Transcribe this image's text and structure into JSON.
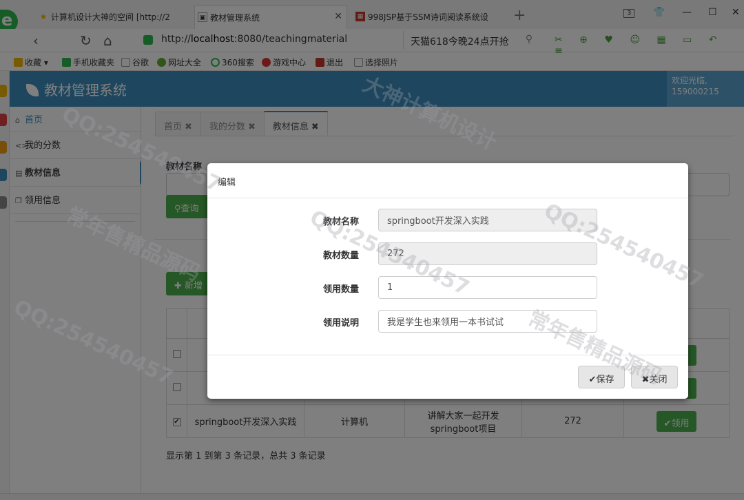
{
  "browser": {
    "tabs": [
      {
        "title": "计算机设计大神的空间 [http://2"
      },
      {
        "title": "教材管理系统"
      },
      {
        "title": "998JSP基于SSM诗词阅读系统设"
      }
    ],
    "tab_count": "3",
    "url_prefix": "http://",
    "url_host": "localhost",
    "url_path": ":8080/teachingmaterial",
    "search_promo": "天猫618今晚24点开抢",
    "bookmarks": [
      "收藏",
      "手机收藏夹",
      "谷歌",
      "网址大全",
      "360搜索",
      "游戏中心",
      "退出",
      "选择照片"
    ]
  },
  "app": {
    "title": "教材管理系统",
    "welcome_line1": "欢迎光临,",
    "welcome_line2": "159000215"
  },
  "sidebar": {
    "items": [
      {
        "label": "首页",
        "icon": "home-icon"
      },
      {
        "label": "我的分数",
        "icon": "code-icon"
      },
      {
        "label": "教材信息",
        "icon": "book-icon"
      },
      {
        "label": "领用信息",
        "icon": "clone-icon"
      }
    ]
  },
  "content_tabs": [
    {
      "label": "首页"
    },
    {
      "label": "我的分数"
    },
    {
      "label": "教材信息"
    }
  ],
  "search": {
    "label": "教材名称",
    "query_button": "查询"
  },
  "toolbar": {
    "add_button": "新增"
  },
  "table": {
    "rows": [
      {
        "checked": false,
        "name": "",
        "category": "",
        "desc1": "",
        "desc2": "",
        "qty": "",
        "action": ""
      },
      {
        "checked": false,
        "name": "",
        "category": "",
        "desc1": "",
        "desc2": "",
        "qty": "",
        "action": ""
      },
      {
        "checked": true,
        "name": "springboot开发深入实践",
        "category": "计算机",
        "desc1": "讲解大家一起开发",
        "desc2": "springboot项目",
        "qty": "272",
        "action": "领用"
      }
    ],
    "page_info": "显示第 1 到第 3 条记录，总共 3 条记录"
  },
  "modal": {
    "title": "编辑",
    "fields": [
      {
        "label": "教材名称",
        "value": "springboot开发深入实践",
        "readonly": true
      },
      {
        "label": "教材数量",
        "value": "272",
        "readonly": true
      },
      {
        "label": "领用数量",
        "value": "1",
        "readonly": false
      },
      {
        "label": "领用说明",
        "value": "我是学生也来领用一本书试试",
        "readonly": false
      }
    ],
    "save_button": "保存",
    "close_button": "关闭"
  },
  "watermark": {
    "qq": "QQ:254540457",
    "slogan1": "常年售精品源码",
    "slogan2": "大神计算机设计"
  },
  "colors": {
    "header": "#3c8dbc",
    "success": "#4cae4c",
    "overlay": "rgba(0,0,0,0.5)"
  }
}
